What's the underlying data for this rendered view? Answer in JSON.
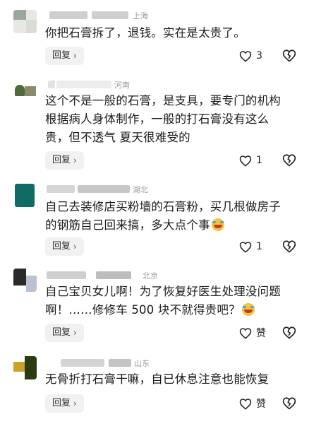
{
  "comments": [
    {
      "location": "上海",
      "text_lines": [
        "你把石膏拆了，退钱。实在是太贵了。"
      ],
      "reply_label": "回复",
      "like_count": "3"
    },
    {
      "location": "河南",
      "text_lines": [
        "这个不是一般的石膏，是支具，要专门的机构",
        "根据病人身体制作，一般的打石膏没有这么",
        "贵，但不透气 夏天很难受的"
      ],
      "reply_label": "回复",
      "like_count": "1"
    },
    {
      "location": "湖北",
      "text_lines": [
        "自己去装修店买粉墙的石膏粉，买几根做房子",
        "的钢筋自己回来搞，多大点个事"
      ],
      "reply_label": "回复",
      "like_count": "1"
    },
    {
      "location": "北京",
      "text_lines": [
        "自己宝贝女儿啊！为了恢复好医生处理没问题",
        "啊！……修修车 500 块不就得贵吧？"
      ],
      "reply_label": "回复",
      "like_count": "赞"
    },
    {
      "location": "山东",
      "text_lines": [
        "无骨折打石膏干嘛，自已休息注意也能恢复"
      ],
      "reply_label": "回复",
      "like_count": "赞"
    }
  ],
  "icons": {
    "like": "heart-outline-icon",
    "dislike": "broken-heart-icon",
    "reply_arrow": "chevron-right-icon",
    "emoji": "laughing-crying-emoji-icon"
  }
}
